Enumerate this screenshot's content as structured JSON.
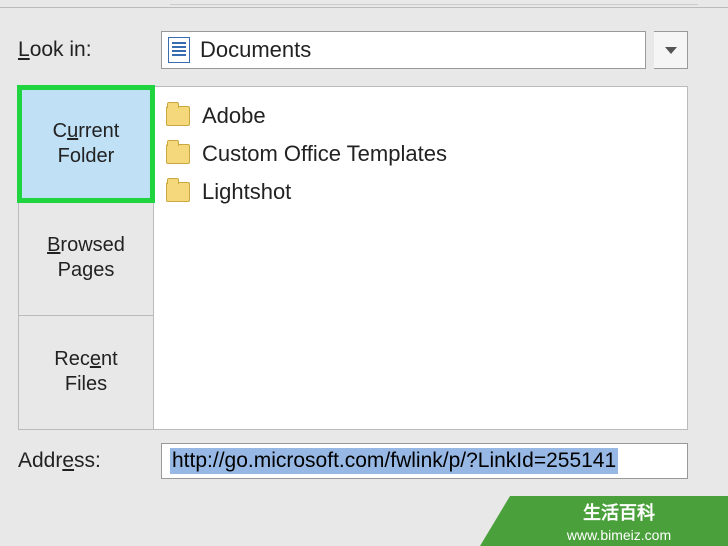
{
  "lookIn": {
    "label_prefix": "L",
    "label_rest": "ook in:",
    "value": "Documents"
  },
  "tabs": {
    "current": {
      "prefix": "C",
      "mid": "u",
      "rest": "rrent",
      "line2": "Folder"
    },
    "browsed": {
      "prefix": "B",
      "rest": "rowsed",
      "line2": "Pages"
    },
    "recent": {
      "prefix": "Rec",
      "mid": "e",
      "rest": "nt",
      "line2": "Files"
    }
  },
  "files": [
    {
      "name": "Adobe"
    },
    {
      "name": "Custom Office Templates"
    },
    {
      "name": "Lightshot"
    }
  ],
  "address": {
    "label_prefix": "Addr",
    "label_mid": "e",
    "label_rest": "ss:",
    "value": "http://go.microsoft.com/fwlink/p/?LinkId=255141"
  },
  "watermark": {
    "title": "生活百科",
    "url": "www.bimeiz.com"
  }
}
